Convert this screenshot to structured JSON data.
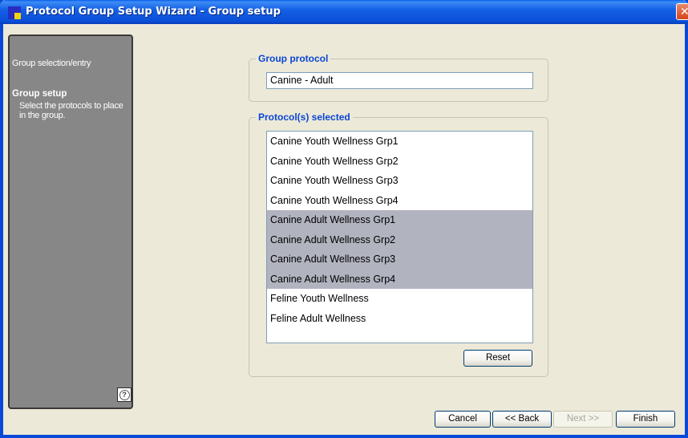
{
  "window": {
    "title": "Protocol Group Setup Wizard - Group setup",
    "close_glyph": "✕"
  },
  "sidebar": {
    "step1_label": "Group selection/entry",
    "step2_label": "Group setup",
    "step2_desc": "Select the protocols to place in the group.",
    "help_glyph": "?"
  },
  "group_protocol": {
    "label": "Group protocol",
    "value": "Canine - Adult"
  },
  "protocols_selected": {
    "label": "Protocol(s) selected",
    "items": [
      {
        "label": "Canine Youth Wellness Grp1",
        "selected": false
      },
      {
        "label": "Canine Youth Wellness Grp2",
        "selected": false
      },
      {
        "label": "Canine Youth Wellness Grp3",
        "selected": false
      },
      {
        "label": "Canine Youth Wellness Grp4",
        "selected": false
      },
      {
        "label": "Canine Adult Wellness Grp1",
        "selected": true
      },
      {
        "label": "Canine Adult Wellness Grp2",
        "selected": true
      },
      {
        "label": "Canine Adult Wellness Grp3",
        "selected": true
      },
      {
        "label": "Canine Adult Wellness Grp4",
        "selected": true
      },
      {
        "label": "Feline Youth Wellness",
        "selected": false
      },
      {
        "label": "Feline Adult Wellness",
        "selected": false
      }
    ],
    "reset_label": "Reset"
  },
  "footer": {
    "cancel_label": "Cancel",
    "back_label": "<< Back",
    "next_label": "Next >>",
    "finish_label": "Finish"
  },
  "colors": {
    "titlebar": "#0b4fd7",
    "accent_label": "#0a46d5",
    "sidebar_bg": "#878787",
    "selection": "#b1b3bf"
  }
}
